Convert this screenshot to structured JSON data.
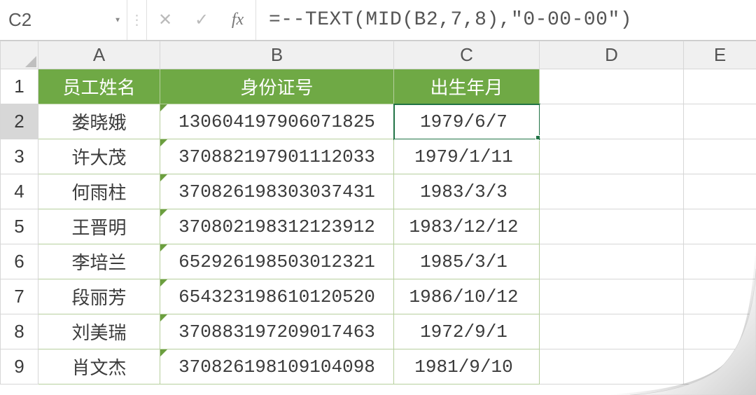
{
  "formula_bar": {
    "namebox": "C2",
    "fx_label": "fx",
    "formula": "=--TEXT(MID(B2,7,8),\"0-00-00\")"
  },
  "columns": [
    "A",
    "B",
    "C",
    "D",
    "E"
  ],
  "row_numbers": [
    1,
    2,
    3,
    4,
    5,
    6,
    7,
    8,
    9
  ],
  "active_row": 2,
  "selected_cell": "C2",
  "headers": {
    "A": "员工姓名",
    "B": "身份证号",
    "C": "出生年月"
  },
  "chart_data": {
    "type": "table",
    "columns": [
      "员工姓名",
      "身份证号",
      "出生年月"
    ],
    "rows": [
      {
        "name": "娄晓娥",
        "id": "130604197906071825",
        "dob": "1979/6/7"
      },
      {
        "name": "许大茂",
        "id": "370882197901112033",
        "dob": "1979/1/11"
      },
      {
        "name": "何雨柱",
        "id": "370826198303037431",
        "dob": "1983/3/3"
      },
      {
        "name": "王晋明",
        "id": "370802198312123912",
        "dob": "1983/12/12"
      },
      {
        "name": "李培兰",
        "id": "652926198503012321",
        "dob": "1985/3/1"
      },
      {
        "name": "段丽芳",
        "id": "654323198610120520",
        "dob": "1986/10/12"
      },
      {
        "name": "刘美瑞",
        "id": "370883197209017463",
        "dob": "1972/9/1"
      },
      {
        "name": "肖文杰",
        "id": "370826198109104098",
        "dob": "1981/9/10"
      }
    ]
  }
}
